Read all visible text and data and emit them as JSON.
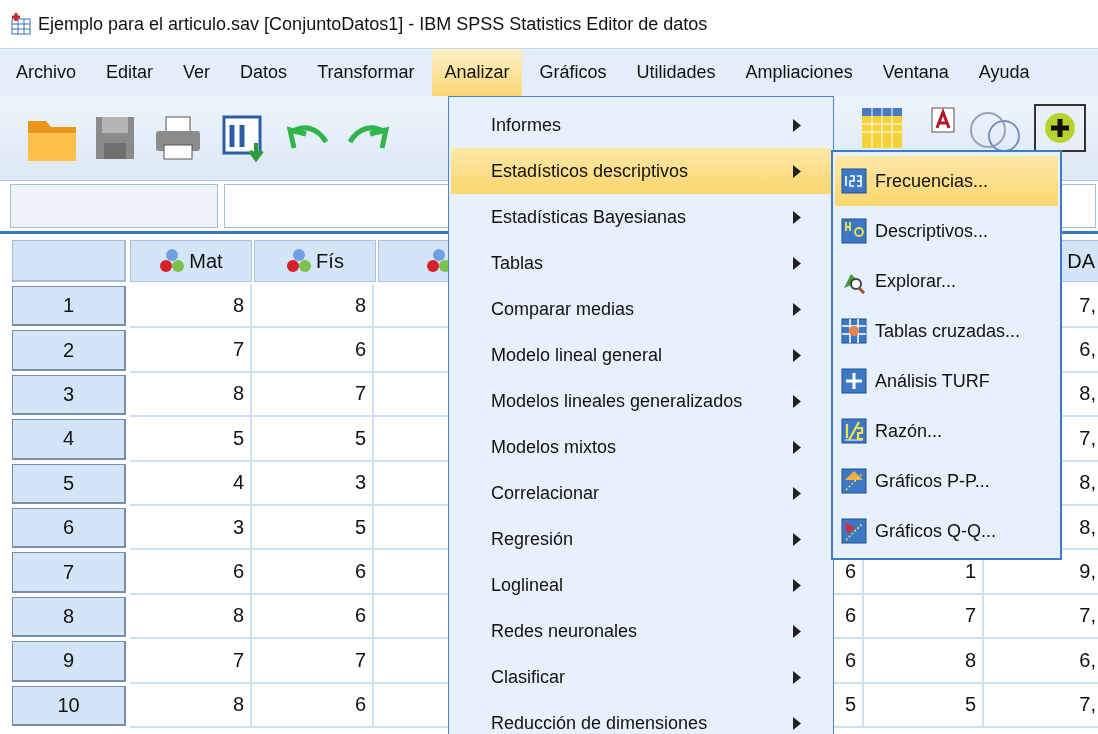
{
  "window": {
    "title": "Ejemplo para el articulo.sav [ConjuntoDatos1] - IBM SPSS Statistics Editor de datos"
  },
  "menu_bar": [
    {
      "label": "Archivo",
      "selected": false
    },
    {
      "label": "Editar",
      "selected": false
    },
    {
      "label": "Ver",
      "selected": false
    },
    {
      "label": "Datos",
      "selected": false
    },
    {
      "label": "Transformar",
      "selected": false
    },
    {
      "label": "Analizar",
      "selected": true
    },
    {
      "label": "Gráficos",
      "selected": false
    },
    {
      "label": "Utilidades",
      "selected": false
    },
    {
      "label": "Ampliaciones",
      "selected": false
    },
    {
      "label": "Ventana",
      "selected": false
    },
    {
      "label": "Ayuda",
      "selected": false
    }
  ],
  "table": {
    "columns": [
      {
        "kind": "variable",
        "label": "Mat"
      },
      {
        "kind": "variable",
        "label": "Fís"
      },
      {
        "kind": "variable"
      },
      null,
      null,
      null,
      null,
      {
        "kind": "name",
        "label": "DA"
      }
    ],
    "rows": [
      {
        "number": "1",
        "cells": [
          "8",
          "8",
          null,
          null,
          null,
          null,
          null,
          "7,"
        ]
      },
      {
        "number": "2",
        "cells": [
          "7",
          "6",
          null,
          null,
          null,
          null,
          null,
          "6,"
        ]
      },
      {
        "number": "3",
        "cells": [
          "8",
          "7",
          null,
          null,
          null,
          null,
          null,
          "8,"
        ]
      },
      {
        "number": "4",
        "cells": [
          "5",
          "5",
          null,
          null,
          null,
          null,
          null,
          "7,"
        ]
      },
      {
        "number": "5",
        "cells": [
          "4",
          "3",
          null,
          null,
          null,
          null,
          null,
          "8,"
        ]
      },
      {
        "number": "6",
        "cells": [
          "3",
          "5",
          null,
          null,
          null,
          null,
          null,
          "8,"
        ]
      },
      {
        "number": "7",
        "cells": [
          "6",
          "6",
          null,
          null,
          null,
          "6",
          "1",
          "9,"
        ]
      },
      {
        "number": "8",
        "cells": [
          "8",
          "6",
          null,
          null,
          null,
          "6",
          "7",
          "7,"
        ]
      },
      {
        "number": "9",
        "cells": [
          "7",
          "7",
          null,
          null,
          null,
          "6",
          "8",
          "6,"
        ]
      },
      {
        "number": "10",
        "cells": [
          "8",
          "6",
          null,
          null,
          null,
          "5",
          "5",
          "7,"
        ]
      }
    ]
  },
  "analyze_menu": {
    "items": [
      {
        "label": "Informes",
        "selected": false
      },
      {
        "label": "Estadísticos descriptivos",
        "selected": true
      },
      {
        "label": "Estadísticas Bayesianas",
        "selected": false
      },
      {
        "label": "Tablas",
        "selected": false
      },
      {
        "label": "Comparar medias",
        "selected": false
      },
      {
        "label": "Modelo lineal general",
        "selected": false
      },
      {
        "label": "Modelos lineales generalizados",
        "selected": false
      },
      {
        "label": "Modelos mixtos",
        "selected": false
      },
      {
        "label": "Correlacionar",
        "selected": false
      },
      {
        "label": "Regresión",
        "selected": false
      },
      {
        "label": "Loglineal",
        "selected": false
      },
      {
        "label": "Redes neuronales",
        "selected": false
      },
      {
        "label": "Clasificar",
        "selected": false
      },
      {
        "label": "Reducción de dimensiones",
        "selected": false
      }
    ]
  },
  "descriptive_submenu": {
    "items": [
      {
        "label": "Frecuencias...",
        "selected": true
      },
      {
        "label": "Descriptivos...",
        "selected": false
      },
      {
        "label": "Explorar...",
        "selected": false
      },
      {
        "label": "Tablas cruzadas...",
        "selected": false
      },
      {
        "label": "Análisis TURF",
        "selected": false
      },
      {
        "label": "Razón...",
        "selected": false
      },
      {
        "label": "Gráficos P-P...",
        "selected": false
      },
      {
        "label": "Gráficos Q-Q...",
        "selected": false
      }
    ]
  }
}
